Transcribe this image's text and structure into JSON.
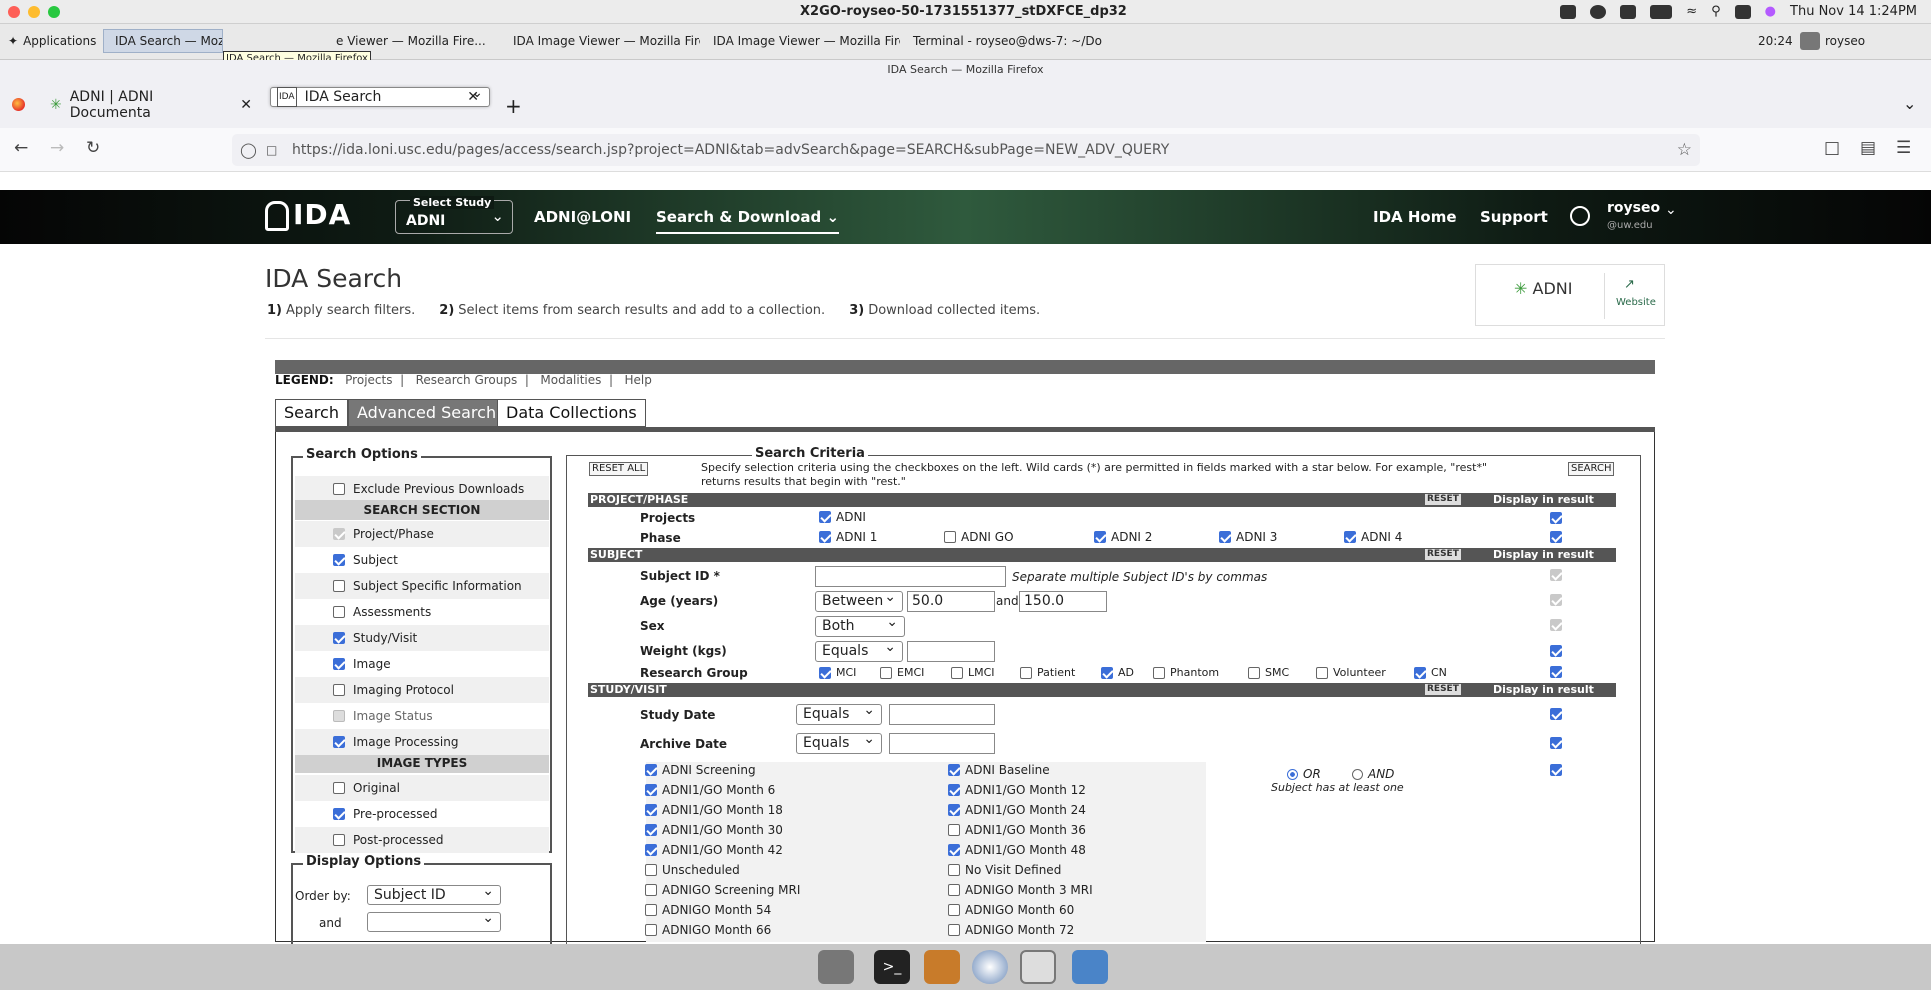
{
  "mac": {
    "title": "X2GO-royseo-50-1731551377_stDXFCE_dp32",
    "time": "Thu Nov 14  1:24PM"
  },
  "taskbar": {
    "applications": "Applications",
    "tasks": [
      "IDA Search — Mozill",
      "IDA Search — Mozilla Firefox",
      "e Viewer — Mozilla Fire...",
      "IDA Image Viewer — Mozilla Fire...",
      "IDA Image Viewer — Mozilla Fire...",
      "Terminal - royseo@dws-7: ~/Do..."
    ],
    "clock": "20:24",
    "user": "royseo"
  },
  "firefox": {
    "title": "IDA Search — Mozilla Firefox",
    "tabs": [
      "ADNI |  ADNI Documenta",
      "IDA Search"
    ],
    "url": "https://ida.loni.usc.edu/pages/access/search.jsp?project=ADNI&tab=advSearch&page=SEARCH&subPage=NEW_ADV_QUERY"
  },
  "header": {
    "logo": "IDA",
    "study_label": "Select Study",
    "study_value": "ADNI",
    "adni_loni": "ADNI@LONI",
    "search_download": "Search & Download",
    "ida_home": "IDA Home",
    "support": "Support",
    "user": "royseo",
    "user_domain": "@uw.edu"
  },
  "page": {
    "title": "IDA Search",
    "steps": [
      {
        "num": "1)",
        "text": "Apply search filters."
      },
      {
        "num": "2)",
        "text": "Select items from search results and add to a collection."
      },
      {
        "num": "3)",
        "text": "Download collected items."
      }
    ],
    "adni": "ADNI",
    "website": "Website"
  },
  "legend": {
    "label": "LEGEND:",
    "items": [
      "Projects",
      "Research Groups",
      "Modalities",
      "Help"
    ]
  },
  "tabs": [
    "Search",
    "Advanced Search",
    "Data Collections"
  ],
  "options": {
    "title": "Search Options",
    "exclude": "Exclude Previous Downloads",
    "search_section": "SEARCH SECTION",
    "sections": [
      {
        "label": "Project/Phase",
        "state": "disch"
      },
      {
        "label": "Subject",
        "state": "on"
      },
      {
        "label": "Subject Specific Information",
        "state": "off"
      },
      {
        "label": "Assessments",
        "state": "off"
      },
      {
        "label": "Study/Visit",
        "state": "on"
      },
      {
        "label": "Image",
        "state": "on"
      },
      {
        "label": "Imaging Protocol",
        "state": "off"
      },
      {
        "label": "Image Status",
        "state": "dis"
      },
      {
        "label": "Image Processing",
        "state": "on"
      }
    ],
    "image_types": "IMAGE TYPES",
    "types": [
      {
        "label": "Original",
        "state": "off"
      },
      {
        "label": "Pre-processed",
        "state": "on"
      },
      {
        "label": "Post-processed",
        "state": "off"
      }
    ]
  },
  "display": {
    "title": "Display Options",
    "order_by": "Order by:",
    "order_value": "Subject ID",
    "and": "and"
  },
  "criteria": {
    "title": "Search Criteria",
    "reset_all": "RESET ALL",
    "search": "SEARCH",
    "hint": "Specify selection criteria using the checkboxes on the left. Wild cards (*) are permitted in fields marked with a star below. For example, \"rest*\" returns results that begin with \"rest.\"",
    "reset": "RESET",
    "display_in_result": "Display in result",
    "groups": [
      "PROJECT/PHASE",
      "SUBJECT",
      "STUDY/VISIT"
    ],
    "projects_label": "Projects",
    "projects_value": "ADNI",
    "phase_label": "Phase",
    "phases": [
      {
        "label": "ADNI 1",
        "on": true
      },
      {
        "label": "ADNI GO",
        "on": false
      },
      {
        "label": "ADNI 2",
        "on": true
      },
      {
        "label": "ADNI 3",
        "on": true
      },
      {
        "label": "ADNI 4",
        "on": true
      }
    ],
    "subject_id": "Subject ID  *",
    "subject_hint": "Separate multiple Subject ID's by commas",
    "age": "Age (years)",
    "age_op": "Between",
    "age_min": "50.0",
    "age_and": "and",
    "age_max": "150.0",
    "sex": "Sex",
    "sex_value": "Both",
    "weight": "Weight (kgs)",
    "weight_op": "Equals",
    "research_group": "Research Group",
    "groups_rg": [
      {
        "label": "MCI",
        "on": true
      },
      {
        "label": "EMCI",
        "on": false
      },
      {
        "label": "LMCI",
        "on": false
      },
      {
        "label": "Patient",
        "on": false
      },
      {
        "label": "AD",
        "on": true
      },
      {
        "label": "Phantom",
        "on": false
      },
      {
        "label": "SMC",
        "on": false
      },
      {
        "label": "Volunteer",
        "on": false
      },
      {
        "label": "CN",
        "on": true
      }
    ],
    "study_date": "Study Date",
    "archive_date": "Archive Date",
    "date_op": "Equals",
    "visits_left": [
      {
        "label": "ADNI Screening",
        "on": true
      },
      {
        "label": "ADNI1/GO Month 6",
        "on": true
      },
      {
        "label": "ADNI1/GO Month 18",
        "on": true
      },
      {
        "label": "ADNI1/GO Month 30",
        "on": true
      },
      {
        "label": "ADNI1/GO Month 42",
        "on": true
      },
      {
        "label": "Unscheduled",
        "on": false
      },
      {
        "label": "ADNIGO Screening MRI",
        "on": false
      },
      {
        "label": "ADNIGO Month 54",
        "on": false
      },
      {
        "label": "ADNIGO Month 66",
        "on": false
      }
    ],
    "visits_right": [
      {
        "label": "ADNI Baseline",
        "on": true
      },
      {
        "label": "ADNI1/GO Month 12",
        "on": true
      },
      {
        "label": "ADNI1/GO Month 24",
        "on": true
      },
      {
        "label": "ADNI1/GO Month 36",
        "on": false
      },
      {
        "label": "ADNI1/GO Month 48",
        "on": true
      },
      {
        "label": "No Visit Defined",
        "on": false
      },
      {
        "label": "ADNIGO Month 3 MRI",
        "on": false
      },
      {
        "label": "ADNIGO Month 60",
        "on": false
      },
      {
        "label": "ADNIGO Month 72",
        "on": false
      }
    ],
    "or": "OR",
    "and_opt": "AND",
    "at_least": "Subject has at least one"
  }
}
